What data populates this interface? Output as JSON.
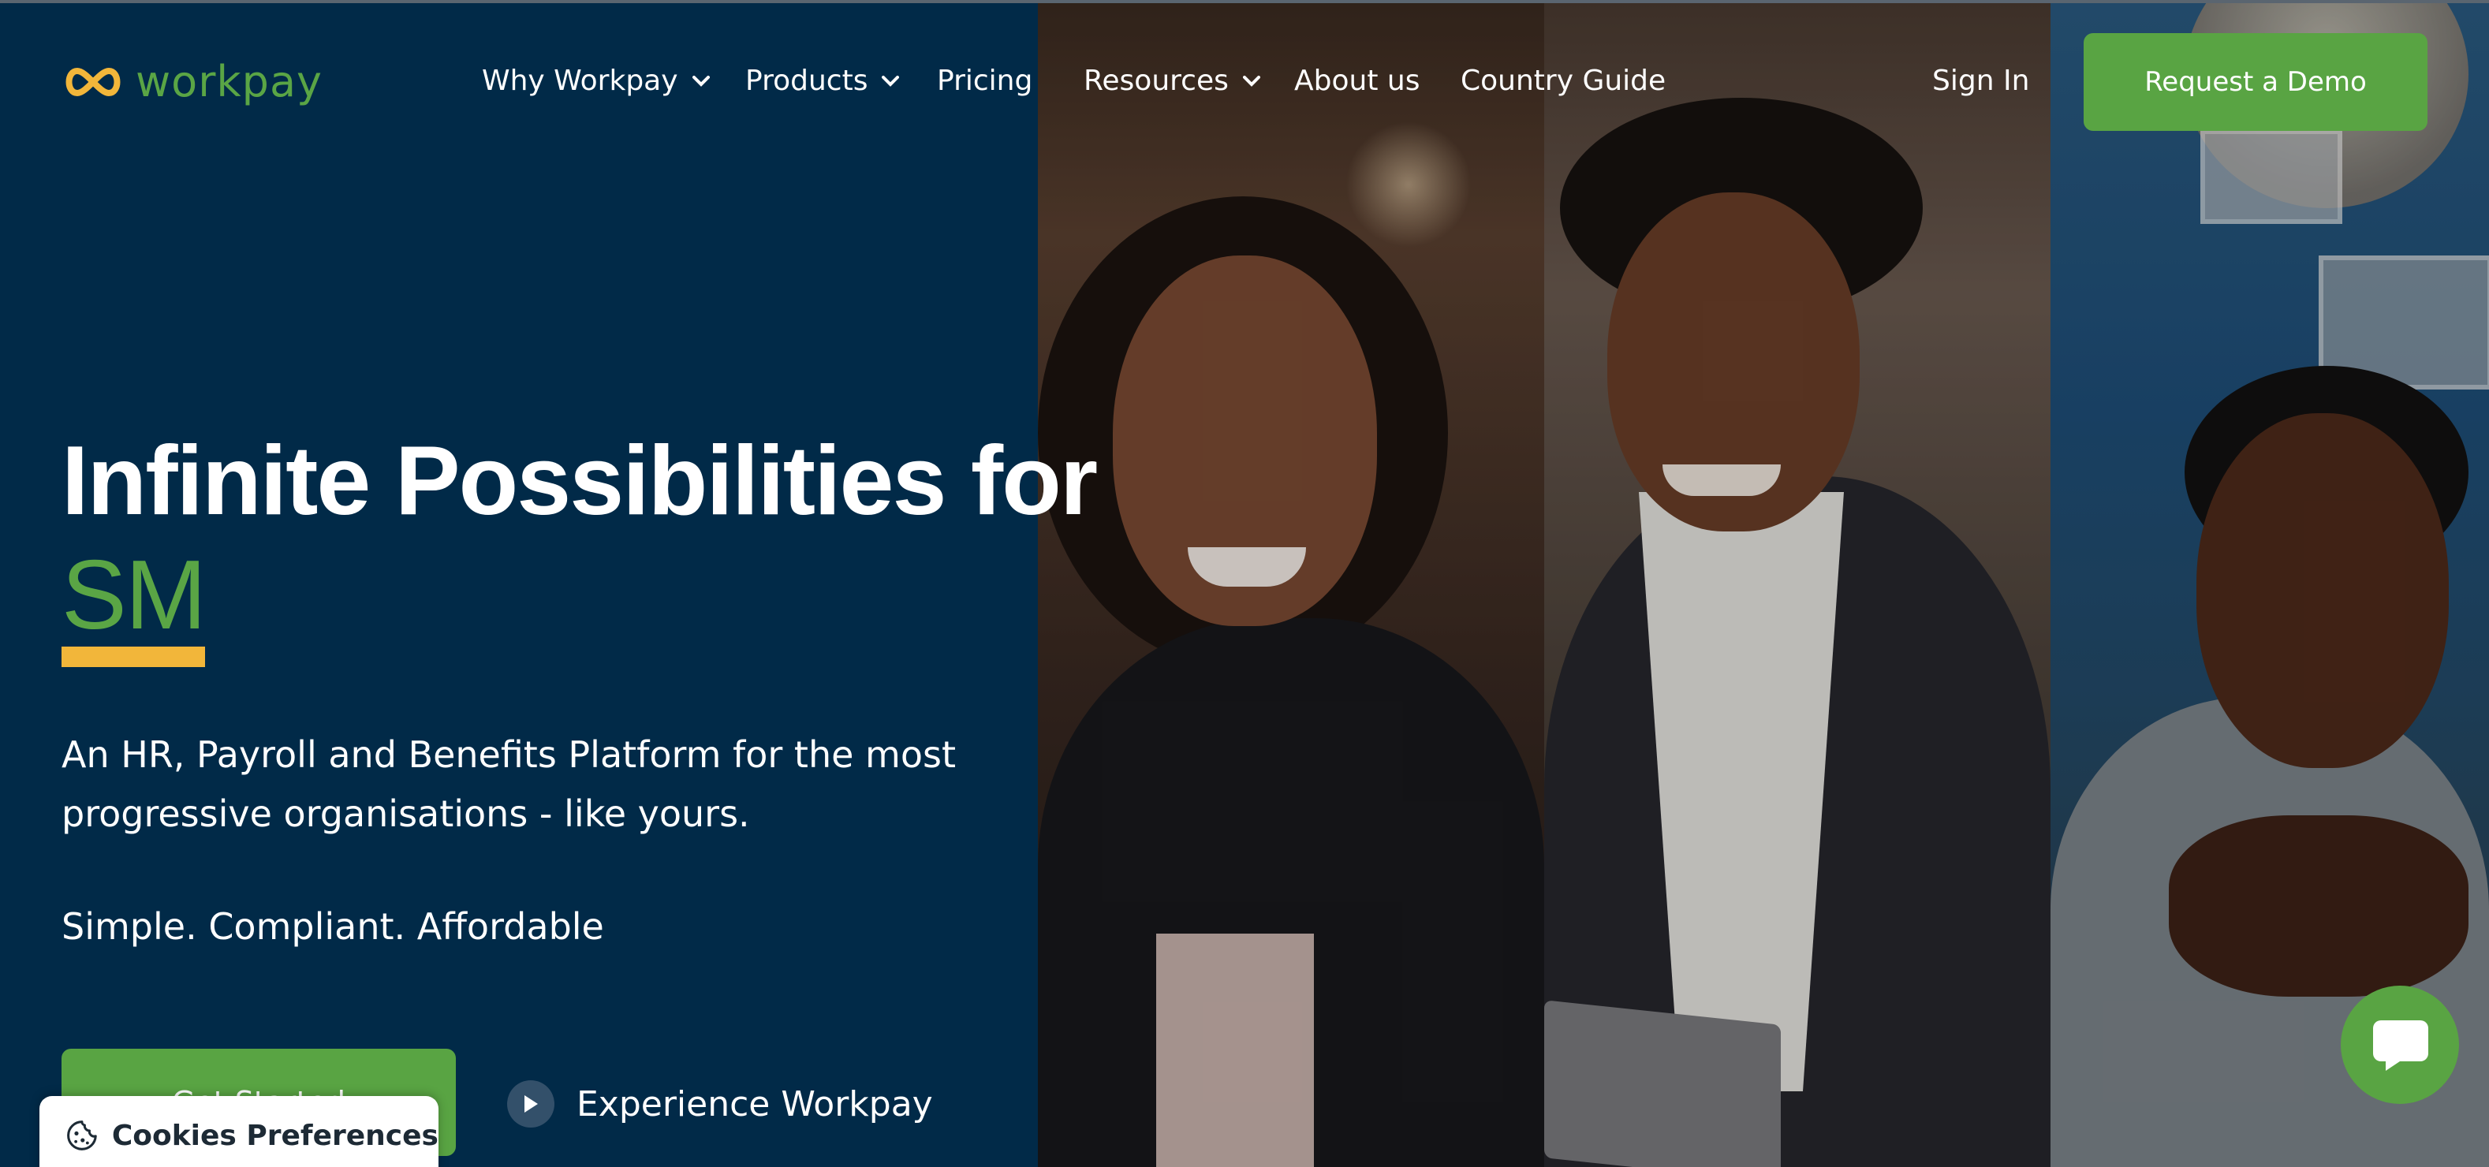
{
  "brand": {
    "name": "workpay",
    "logo_icon": "infinity-icon",
    "colors": {
      "navy": "#012a48",
      "green": "#59a443",
      "yellow": "#f2b63a"
    }
  },
  "nav": {
    "items": [
      {
        "label": "Why Workpay",
        "has_dropdown": true
      },
      {
        "label": "Products",
        "has_dropdown": true
      },
      {
        "label": "Pricing",
        "has_dropdown": false
      },
      {
        "label": "Resources",
        "has_dropdown": true
      },
      {
        "label": "About us",
        "has_dropdown": false
      },
      {
        "label": "Country Guide",
        "has_dropdown": false
      }
    ],
    "sign_in": "Sign In",
    "request_demo": "Request a Demo"
  },
  "hero": {
    "title": "Infinite Possibilities for",
    "rotating_word": "SM",
    "subtitle": "An HR, Payroll and Benefits Platform for the most progressive organisations - like yours.",
    "tagline": "Simple. Compliant. Affordable",
    "cta_primary": "Get Started",
    "cta_secondary": "Experience Workpay",
    "cta_secondary_icon": "play-icon"
  },
  "cookies": {
    "label": "Cookies Preferences",
    "icon": "cookie-icon"
  },
  "chat": {
    "icon": "chat-bubble-icon"
  }
}
